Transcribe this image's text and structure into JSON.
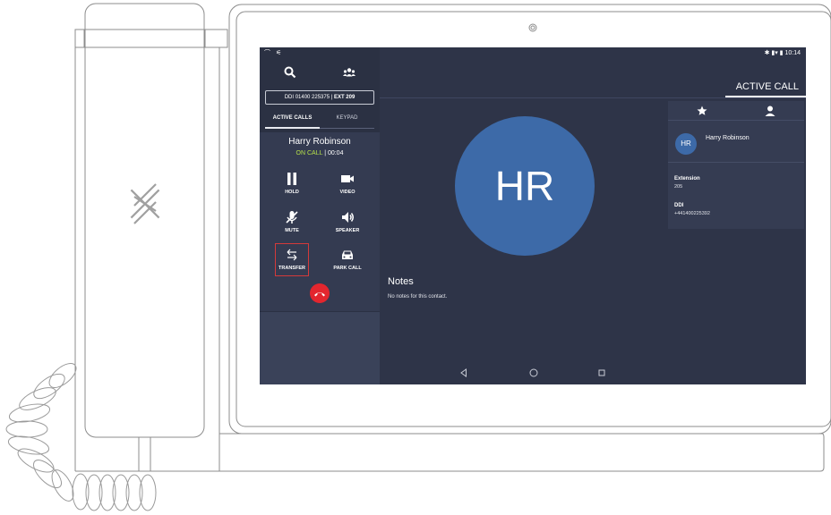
{
  "status_bar": {
    "left_icons": "⌒ ⚟",
    "right_text": "✱ ▮▾ ▮ 10:14"
  },
  "left_panel": {
    "search_icon": "search-icon",
    "contacts_icon": "group-icon",
    "ddi_prefix": "DDI 01400 225375 | ",
    "ddi_ext": "EXT 209",
    "tabs": [
      {
        "label": "ACTIVE CALLS",
        "active": true
      },
      {
        "label": "KEYPAD",
        "active": false
      }
    ],
    "caller_name": "Harry Robinson",
    "call_status": "ON CALL",
    "call_timer": "| 00:04",
    "controls": [
      {
        "label": "HOLD",
        "icon": "pause-icon"
      },
      {
        "label": "VIDEO",
        "icon": "video-camera-icon"
      },
      {
        "label": "MUTE",
        "icon": "mic-off-icon"
      },
      {
        "label": "SPEAKER",
        "icon": "speaker-icon"
      },
      {
        "label": "TRANSFER",
        "icon": "transfer-arrows-icon",
        "highlighted": true
      },
      {
        "label": "PARK CALL",
        "icon": "car-icon"
      }
    ],
    "hangup_icon": "hang-up-icon"
  },
  "main": {
    "header": "ACTIVE CALL",
    "avatar_initials": "HR",
    "notes_title": "Notes",
    "notes_body": "No notes for this contact."
  },
  "contact_card": {
    "tabs": [
      {
        "icon": "star-icon"
      },
      {
        "icon": "person-icon"
      }
    ],
    "initials": "HR",
    "name": "Harry Robinson",
    "extension_label": "Extension",
    "extension_value": "205",
    "ddi_label": "DDI",
    "ddi_value": "+441400225392"
  },
  "nav_bar": [
    {
      "icon": "back-triangle-icon"
    },
    {
      "icon": "home-circle-icon"
    },
    {
      "icon": "recents-square-icon"
    }
  ],
  "colors": {
    "screen_bg": "#2e3448",
    "left_panel_bg": "#2b3143",
    "avatar": "#3d6aa8",
    "on_call": "#b6e04a",
    "hangup": "#e3262e",
    "highlight": "#d43a3a"
  }
}
